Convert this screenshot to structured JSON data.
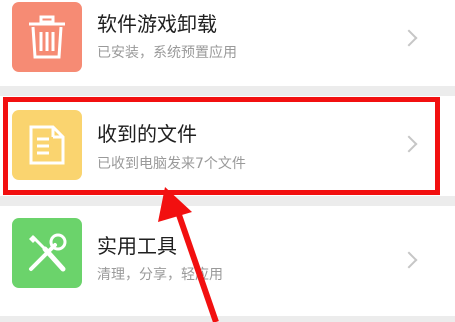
{
  "items": [
    {
      "title": "软件游戏卸载",
      "subtitle": "已安装，系统预置应用",
      "icon": "trash-icon",
      "color": "#f68b74"
    },
    {
      "title": "收到的文件",
      "subtitle": "已收到电脑发来7个文件",
      "icon": "document-icon",
      "color": "#fad46f"
    },
    {
      "title": "实用工具",
      "subtitle": "清理，分享，轻应用",
      "icon": "tools-icon",
      "color": "#6bd36b"
    }
  ],
  "annotation": {
    "highlight_color": "#f21010"
  }
}
